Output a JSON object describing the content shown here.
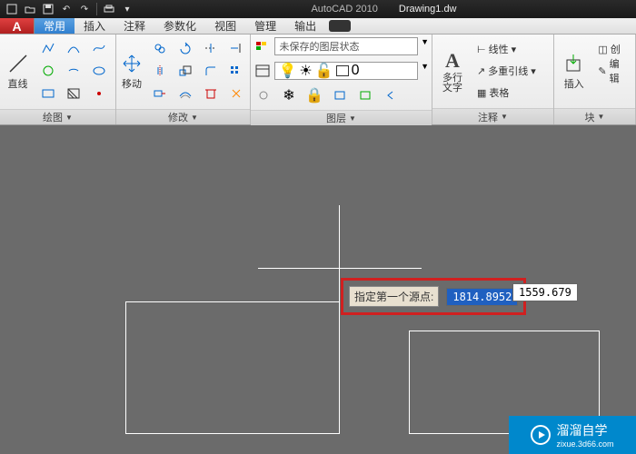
{
  "title": {
    "app": "AutoCAD 2010",
    "file": "Drawing1.dw"
  },
  "tabs": [
    "常用",
    "插入",
    "注释",
    "参数化",
    "视图",
    "管理",
    "输出"
  ],
  "active_tab": 0,
  "panels": {
    "draw": {
      "label": "绘图",
      "big_btn": "直线"
    },
    "modify": {
      "label": "修改",
      "big_btn": "移动"
    },
    "layer": {
      "label": "图层",
      "state": "未保存的图层状态",
      "current": "0"
    },
    "annot": {
      "label": "注释",
      "big_btn1": "A",
      "big_btn1_lbl": "多行\n文字",
      "row1": "线性",
      "row2": "多重引线",
      "row3": "表格"
    },
    "block": {
      "label": "块",
      "big_btn": "插入",
      "row1": "创",
      "row2": "编辑"
    }
  },
  "prompt": {
    "text": "指定第一个源点:",
    "x": "1814.8952",
    "y": "1559.679"
  },
  "watermark": {
    "brand": "溜溜自学",
    "url": "zixue.3d66.com"
  }
}
